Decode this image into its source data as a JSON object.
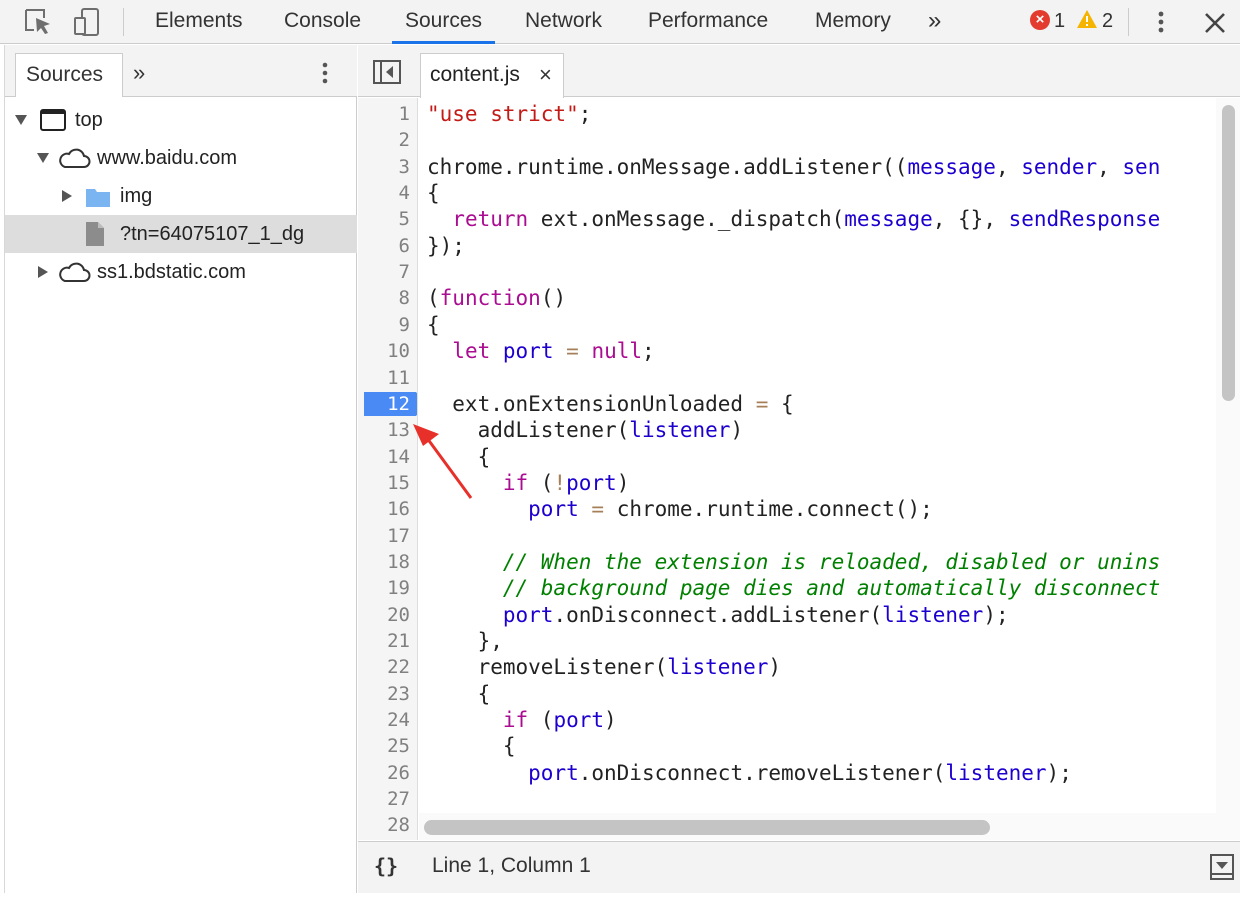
{
  "toolbar": {
    "tabs": [
      "Elements",
      "Console",
      "Sources",
      "Network",
      "Performance",
      "Memory"
    ],
    "active_tab": "Sources",
    "more_label": "»",
    "error_count": "1",
    "warning_count": "2",
    "icons": [
      "inspect-element-icon",
      "device-toolbar-icon",
      "error-icon",
      "warning-icon",
      "kebab-menu-icon",
      "close-icon"
    ]
  },
  "navigator": {
    "tab_label": "Sources",
    "more_label": "»",
    "tree": [
      {
        "label": "top",
        "icon": "frame-icon",
        "expanded": true
      },
      {
        "label": "www.baidu.com",
        "icon": "cloud-icon",
        "expanded": true
      },
      {
        "label": "img",
        "icon": "folder-icon",
        "expanded": false
      },
      {
        "label": "?tn=64075107_1_dg",
        "icon": "file-icon",
        "selected": true
      },
      {
        "label": "ss1.bdstatic.com",
        "icon": "cloud-icon",
        "expanded": false
      }
    ]
  },
  "editor": {
    "open_file": "content.js",
    "close_label": "×",
    "breakpoint_line": 12,
    "line_numbers": [
      "1",
      "2",
      "3",
      "4",
      "5",
      "6",
      "7",
      "8",
      "9",
      "10",
      "11",
      "12",
      "13",
      "14",
      "15",
      "16",
      "17",
      "18",
      "19",
      "20",
      "21",
      "22",
      "23",
      "24",
      "25",
      "26",
      "27",
      "28"
    ],
    "lines": [
      "\"use strict\";",
      "",
      "chrome.runtime.onMessage.addListener((message, sender, sen",
      "{",
      "  return ext.onMessage._dispatch(message, {}, sendResponse",
      "});",
      "",
      "(function()",
      "{",
      "  let port = null;",
      "",
      "  ext.onExtensionUnloaded = {",
      "    addListener(listener)",
      "    {",
      "      if (!port)",
      "        port = chrome.runtime.connect();",
      "",
      "      // When the extension is reloaded, disabled or unins",
      "      // background page dies and automatically disconnect",
      "      port.onDisconnect.addListener(listener);",
      "    },",
      "    removeListener(listener)",
      "    {",
      "      if (port)",
      "      {",
      "        port.onDisconnect.removeListener(listener);",
      "",
      ""
    ],
    "pretty_print_label": "{}",
    "status_text": "Line 1, Column 1"
  },
  "colors": {
    "accent": "#1a73e8",
    "breakpoint": "#4a8af4",
    "annotation_arrow": "#e8302a"
  }
}
